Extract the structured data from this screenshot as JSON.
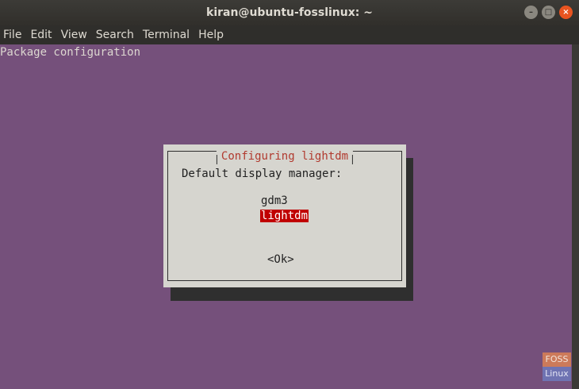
{
  "window": {
    "title": "kiran@ubuntu-fosslinux: ~",
    "buttons": {
      "minimize": "–",
      "maximize": "□",
      "close": "×"
    }
  },
  "menubar": [
    "File",
    "Edit",
    "View",
    "Search",
    "Terminal",
    "Help"
  ],
  "terminal": {
    "header": "Package configuration"
  },
  "dialog": {
    "title": "Configuring lightdm",
    "prompt": "Default display manager:",
    "options": [
      "gdm3",
      "lightdm"
    ],
    "selected": "lightdm",
    "ok": "<Ok>"
  },
  "watermark": {
    "top": "FOSS",
    "bottom": "Linux"
  },
  "colors": {
    "terminal_bg": "#75507b",
    "dialog_bg": "#d6d5cf",
    "dialog_title": "#b13a2f",
    "selection_bg": "#c00000"
  }
}
